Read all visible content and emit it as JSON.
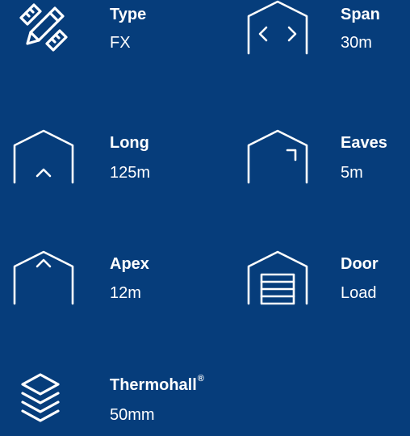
{
  "colors": {
    "background": "#063d7b",
    "foreground": "#ffffff"
  },
  "specs": [
    {
      "id": "type",
      "icon": "pencil-ruler-icon",
      "label": "Type",
      "value": "FX"
    },
    {
      "id": "span",
      "icon": "hall-span-icon",
      "label": "Span",
      "value": "30m"
    },
    {
      "id": "long",
      "icon": "hall-length-icon",
      "label": "Long",
      "value": "125m"
    },
    {
      "id": "eaves",
      "icon": "hall-eaves-icon",
      "label": "Eaves",
      "value": "5m"
    },
    {
      "id": "apex",
      "icon": "hall-apex-icon",
      "label": "Apex",
      "value": "12m"
    },
    {
      "id": "door",
      "icon": "hall-door-icon",
      "label": "Door",
      "value": "Load"
    },
    {
      "id": "thermo",
      "icon": "insulation-layers-icon",
      "label": "Thermohall",
      "label_mark": "®",
      "value": "50mm"
    }
  ]
}
